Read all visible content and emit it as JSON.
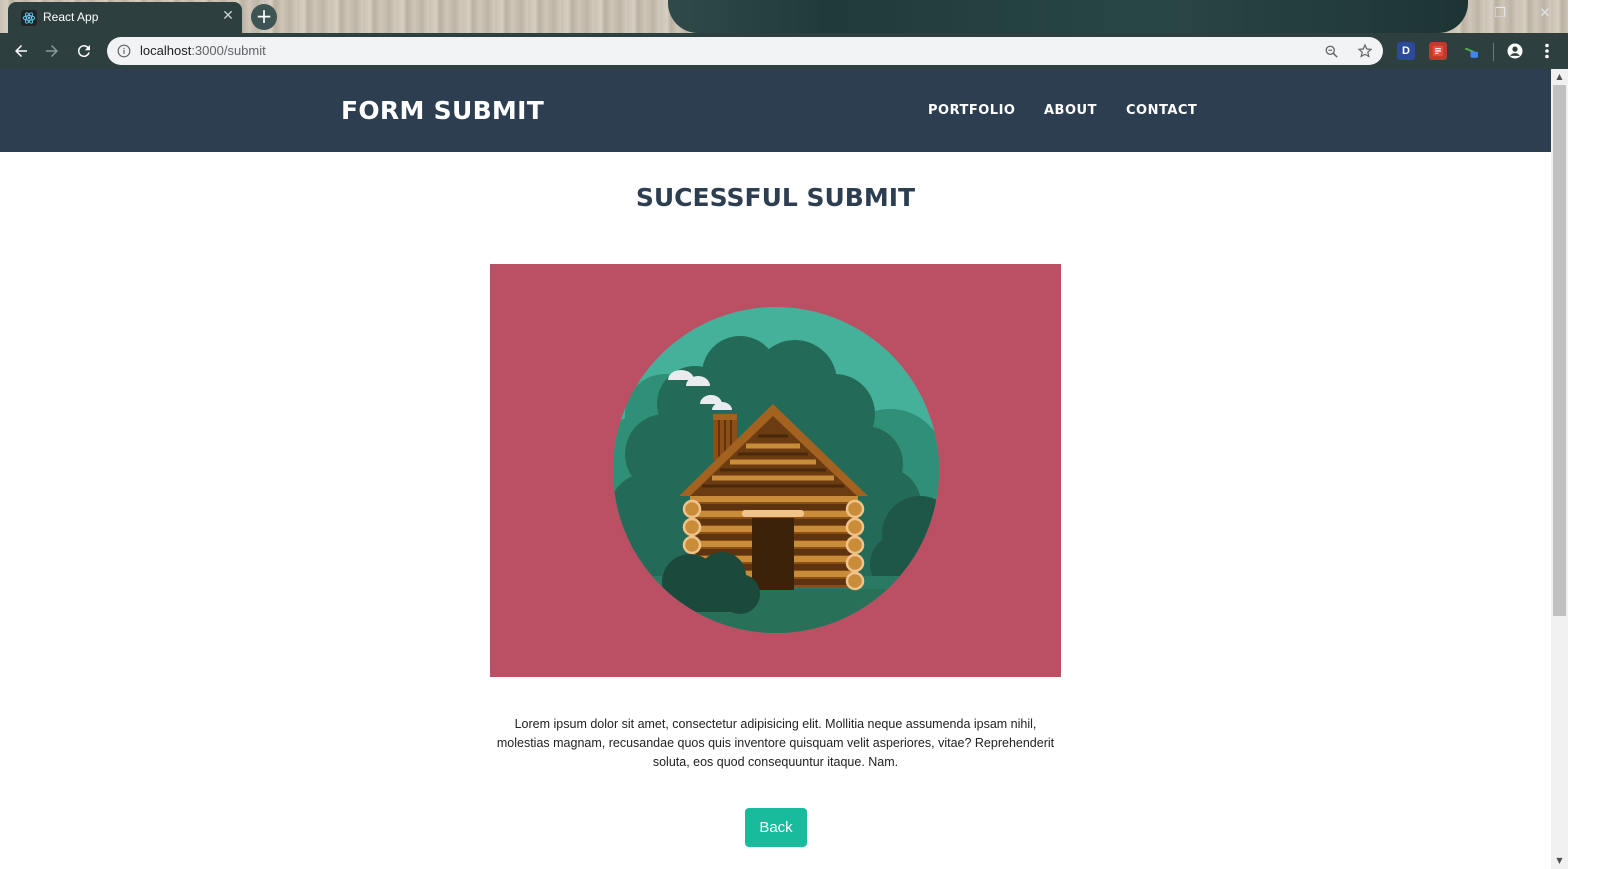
{
  "browser": {
    "tab_title": "React App",
    "tab_close": "✕",
    "new_tab": "+",
    "url_host": "localhost",
    "url_rest": ":3000/submit",
    "extensions": [
      "D"
    ]
  },
  "navbar": {
    "brand": "FORM SUBMIT",
    "links": [
      "PORTFOLIO",
      "ABOUT",
      "CONTACT"
    ],
    "background": "#2c3e50"
  },
  "main": {
    "heading": "SUCESSFUL SUBMIT",
    "hero_background": "#bb5065",
    "paragraph": "Lorem ipsum dolor sit amet, consectetur adipisicing elit. Mollitia neque assumenda ipsam nihil, molestias magnam, recusandae quos quis inventore quisquam velit asperiores, vitae? Reprehenderit soluta, eos quod consequuntur itaque. Nam.",
    "back_label": "Back",
    "accent": "#18bc9c"
  },
  "icons": {
    "tab_favicon": "react-icon",
    "back": "arrow-left-icon",
    "forward": "arrow-right-icon",
    "reload": "reload-icon",
    "info": "info-icon",
    "zoom": "zoom-icon",
    "bookmark": "star-icon",
    "profile": "account-icon",
    "menu": "kebab-menu-icon"
  }
}
